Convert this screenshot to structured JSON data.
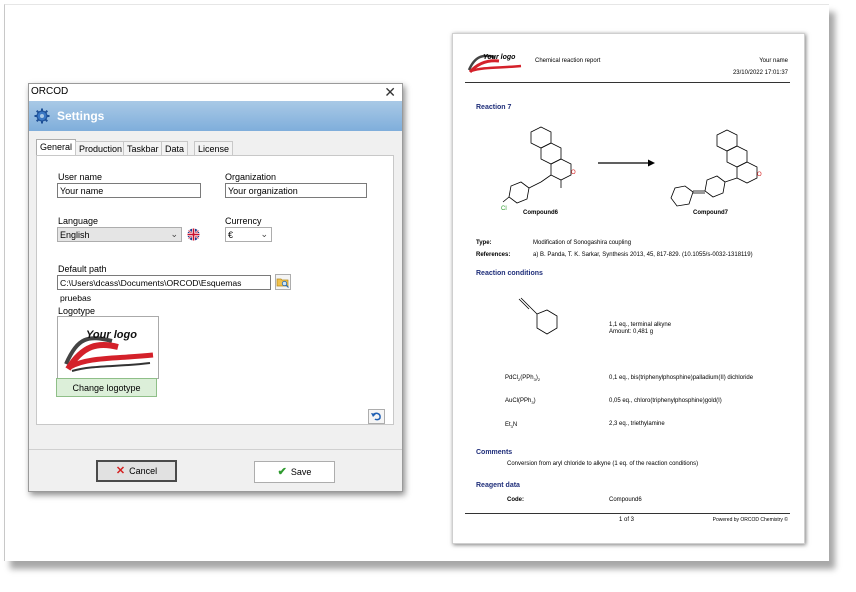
{
  "settings": {
    "window_title": "ORCOD",
    "close": "✕",
    "header": "Settings",
    "tabs": [
      "General",
      "Production",
      "Taskbar",
      "Data",
      "License"
    ],
    "user_name_label": "User name",
    "user_name_value": "Your name",
    "organization_label": "Organization",
    "organization_value": "Your organization",
    "language_label": "Language",
    "language_value": "English",
    "currency_label": "Currency",
    "currency_value": "€",
    "default_path_label": "Default path",
    "default_path_value": "C:\\Users\\dcass\\Documents\\ORCOD\\Esquemas pruebas",
    "logotype_label": "Logotype",
    "logo_text": "Your logo",
    "change_logotype": "Change logotype",
    "cancel": "Cancel",
    "save": "Save"
  },
  "report": {
    "logo_text": "Your logo",
    "doc_title": "Chemical reaction report",
    "user": "Your name",
    "datetime": "23/10/2022 17:01:37",
    "reaction_title": "Reaction 7",
    "compound_left": "Compound6",
    "compound_right": "Compound7",
    "type_label": "Type:",
    "type_value": "Modification of Sonogashira coupling",
    "references_label": "References:",
    "references_value": "a) B. Panda, T. K. Sarkar, Synthesis 2013, 45, 817-829. (10.1055/s-0032-1318119)",
    "conditions_title": "Reaction conditions",
    "alkyne_line1": "1,1 eq., terminal alkyne",
    "alkyne_line2": "Amount:  0,481 g",
    "reagent1_formula": "PdCl2(PPh3)2",
    "reagent1_desc": "0,1 eq., bis(triphenylphosphine)palladium(II) dichloride",
    "reagent2_formula": "AuCl(PPh3)",
    "reagent2_desc": "0,05 eq., chloro(triphenylphosphine)gold(I)",
    "reagent3_formula": "Et3N",
    "reagent3_desc": "2,3 eq., triethylamine",
    "comments_title": "Comments",
    "comments_value": "Conversion from aryl chloride to alkyne (1 eq. of the reaction conditions)",
    "reagent_data_title": "Reagent data",
    "code_label": "Code:",
    "code_value": "Compound6",
    "page_no": "1 of 3",
    "powered": "Powered by ORCOD Chemistry ©"
  },
  "colors": {
    "accent": "#1f2e7a",
    "banner": "#7faedb",
    "logo_red": "#d4212a"
  }
}
